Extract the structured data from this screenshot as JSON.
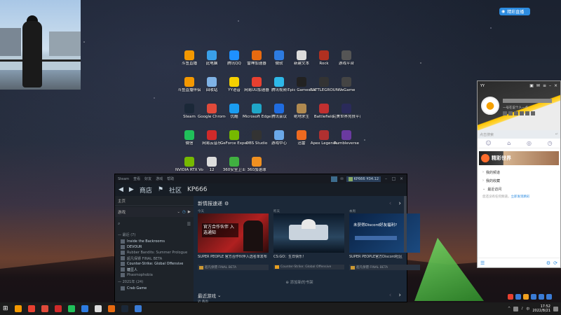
{
  "top_badge": {
    "label": "精彩直播"
  },
  "desktop_icons": [
    {
      "label": "斗鱼直播",
      "color": "#f39800"
    },
    {
      "label": "此电脑",
      "color": "#3aa0e8"
    },
    {
      "label": "腾讯QQ",
      "color": "#1e90ff"
    },
    {
      "label": "雷神加速器",
      "color": "#e86a10"
    },
    {
      "label": "微软",
      "color": "#2d7be0"
    },
    {
      "label": "新建文本",
      "color": "#dcdcdc"
    },
    {
      "label": "Rock",
      "color": "#b03020"
    },
    {
      "label": "游戏平台",
      "color": "#555"
    },
    {
      "label": "斗鱼直播伴侣",
      "color": "#f39800"
    },
    {
      "label": "回收站",
      "color": "#7fb2e5"
    },
    {
      "label": "YY语音",
      "color": "#f5d000"
    },
    {
      "label": "网易UU加速器",
      "color": "#e84030"
    },
    {
      "label": "腾讯视频",
      "color": "#2eb8e8"
    },
    {
      "label": "Epic Games Launcher",
      "color": "#222"
    },
    {
      "label": "BATTLEGROUNDS",
      "color": "#333"
    },
    {
      "label": "WeGame",
      "color": "#444"
    },
    {
      "label": "Steam",
      "color": "#1b2838"
    },
    {
      "label": "Google Chrome",
      "color": "#e04a3a"
    },
    {
      "label": "优酷",
      "color": "#1a9cf0"
    },
    {
      "label": "Microsoft Edge",
      "color": "#1fa6c8"
    },
    {
      "label": "腾讯会议",
      "color": "#1f6ce0"
    },
    {
      "label": "绝地求生",
      "color": "#b08a50"
    },
    {
      "label": "Battlefield",
      "color": "#c03030"
    },
    {
      "label": "完美世界竞技平台",
      "color": "#2a2a5a"
    },
    {
      "label": "微信",
      "color": "#20c05a"
    },
    {
      "label": "网易云音乐",
      "color": "#d02a2a"
    },
    {
      "label": "GeForce Experience",
      "color": "#76b900"
    },
    {
      "label": "OBS Studio",
      "color": "#333"
    },
    {
      "label": "游戏中心",
      "color": "#6aa8e8"
    },
    {
      "label": "迅雷",
      "color": "#ee6a20"
    },
    {
      "label": "Apex Legends",
      "color": "#b03030"
    },
    {
      "label": "Rumbleverse",
      "color": "#6a3aa0"
    },
    {
      "label": "NVIDIA RTX Voice",
      "color": "#76b900"
    },
    {
      "label": "12",
      "color": "#dcdcdc"
    },
    {
      "label": "360安全卫士",
      "color": "#40b040"
    },
    {
      "label": "360加速球",
      "color": "#f09020"
    }
  ],
  "steam": {
    "titlebar": {
      "menus": [
        "Steam",
        "查看",
        "好友",
        "游戏",
        "帮助"
      ],
      "username": "KP666",
      "balance": "¥34.12"
    },
    "nav": {
      "store": "商店",
      "community": "社区",
      "profile": "KP666"
    },
    "sidebar": {
      "home": "主页",
      "games": "游戏",
      "recent_section": "最近",
      "recent_count": "(7)",
      "games_list": [
        {
          "name": "Inside the Backrooms",
          "dim": false
        },
        {
          "name": "DEVOUR",
          "dim": false
        },
        {
          "name": "Rubber Bandits: Summer Prologue",
          "dim": true
        },
        {
          "name": "超凡保镖 FINAL BETA",
          "dim": true
        },
        {
          "name": "Counter-Strike: Global Offensive",
          "dim": false
        },
        {
          "name": "糖豆人",
          "dim": false
        },
        {
          "name": "Phasmophobia",
          "dim": true
        }
      ],
      "year_section": "2021年",
      "year_count": "(24)",
      "year_games": [
        {
          "name": "Crab Game"
        }
      ]
    },
    "whats_new": {
      "title": "新情报速递",
      "cards": [
        {
          "tag": "今天",
          "image_text": "官方合作伙伴 入选通知",
          "caption": "SUPER PEOPLE 官方合作伙伴入选名单发布",
          "game": "超凡保镖 FINAL BETA"
        },
        {
          "tag": "昨天",
          "image_text": "",
          "caption": "CS:GO：生日快乐！",
          "game": "Counter-Strike: Global Offensive"
        },
        {
          "tag": "本周",
          "image_text": "未获得Discord好友福利?",
          "caption": "SUPER PEOPLE官方Discord社区",
          "game": "超凡保镖 FINAL BETA"
        }
      ],
      "add_shelf": "添加新的书架"
    },
    "recent_games": {
      "title": "最近游戏",
      "tag": "近 两周"
    }
  },
  "qq": {
    "title": "YY",
    "signature": "一号在说个人一点",
    "search_placeholder": "点击搜索",
    "banner": "精彩世界",
    "items": [
      "我的频道",
      "我的收藏",
      "最近访问"
    ],
    "note": "您还没有任何频道，",
    "note_link": "立即发现精彩"
  },
  "taskbar": {
    "time": "17:52",
    "date": "2022/8/21",
    "apps": [
      "#f39800",
      "#e84030",
      "#e04a3a",
      "#d02a2a",
      "#20c05a",
      "#2d7be0",
      "#dcdcdc",
      "#e86a10",
      "#1b2838",
      "#3a7bd5"
    ]
  }
}
